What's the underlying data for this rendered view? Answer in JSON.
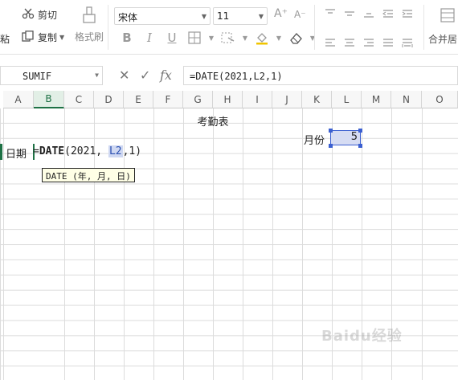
{
  "ribbon": {
    "paste_label": "粘",
    "cut_label": "剪切",
    "copy_label": "复制",
    "format_painter_label": "格式刷",
    "font_name": "宋体",
    "font_size": "11",
    "merge_label": "合并居",
    "font_buttons": [
      "B",
      "I",
      "U"
    ],
    "grow_symbol": "A⁺",
    "shrink_symbol": "A⁻"
  },
  "formula_bar": {
    "name_box": "SUMIF",
    "cancel_symbol": "✕",
    "confirm_symbol": "✓",
    "fx_symbol": "fx",
    "formula": "=DATE(2021,L2,1)"
  },
  "sheet": {
    "columns": [
      "A",
      "B",
      "C",
      "D",
      "E",
      "F",
      "G",
      "H",
      "I",
      "J",
      "K",
      "L",
      "M",
      "N",
      "O"
    ],
    "active_column": "B",
    "title": "考勤表",
    "date_label": "日期",
    "edit": {
      "prefix": "=",
      "fn": "DATE",
      "open": "(2021, ",
      "ref": "L2",
      "close": ",1)"
    },
    "tooltip": "DATE (年, 月, 日)",
    "month_label": "月份",
    "month_value": "5"
  },
  "watermark": "Baidu经验",
  "colors": {
    "accent_green": "#1e7145",
    "ref_blue": "#3b5fd0",
    "ref_fill": "#d6dcf3"
  }
}
